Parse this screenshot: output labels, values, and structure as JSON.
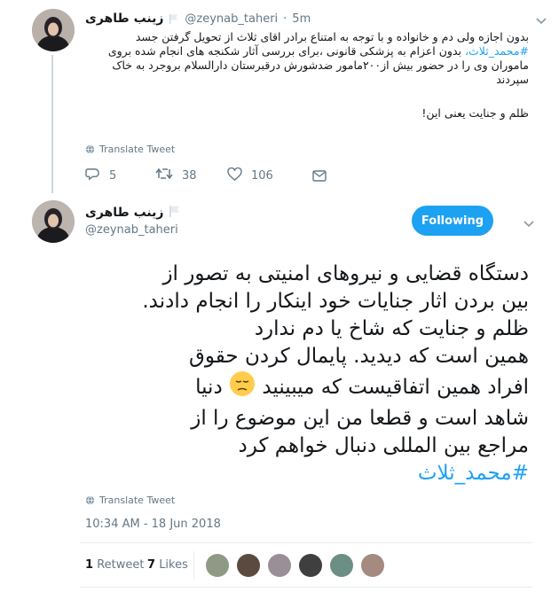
{
  "reply": {
    "name": "زینب طاهری",
    "handle": "@zeynab_taheri",
    "time": "5m",
    "text_lines": [
      "بدون اجازه ولی دم و خانواده و با توجه به امتناع برادر اقای ثلاث از تحویل گرفتن جسد",
      "بدون اعزام به پزشکی قانونی ،برای بررسی آثار شکنجه های انجام شده بروی",
      "ماموران وی را در حضور بیش از۲۰۰مامور ضدشورش درقبرستان دارالسلام بروجرد به خاک",
      "سپردند",
      "ظلم و جنایت یعنی این!"
    ],
    "hashtag": "#محمد_ثلاث،",
    "translate": "Translate Tweet",
    "replies": "5",
    "retweets": "38",
    "likes": "106"
  },
  "main": {
    "name": "زینب طاهری",
    "handle": "@zeynab_taheri",
    "follow_label": "Following",
    "text_lines": [
      "دستگاه قضایی و نیروهای امنیتی به تصور از",
      "بین بردن اثار جنایات خود اینکار را انجام دادند.",
      "ظلم و جنایت که شاخ یا دم ندارد",
      "همین است که دیدید. پایمال کردن حقوق",
      "افراد همین اتفاقیست که میبینید",
      "دنیا",
      "شاهد است و قطعا من این موضوع را از",
      "مراجع بین المللی دنبال خواهم کرد"
    ],
    "hashtag": "#محمد_ثلاث",
    "translate": "Translate Tweet",
    "timestamp": "10:34 AM - 18 Jun 2018",
    "retweet_count": "1",
    "retweet_label": "Retweet",
    "like_count": "7",
    "like_label": "Likes"
  },
  "colors": {
    "accent": "#1da1f2",
    "muted": "#657786",
    "divider": "#e6ecf0"
  }
}
